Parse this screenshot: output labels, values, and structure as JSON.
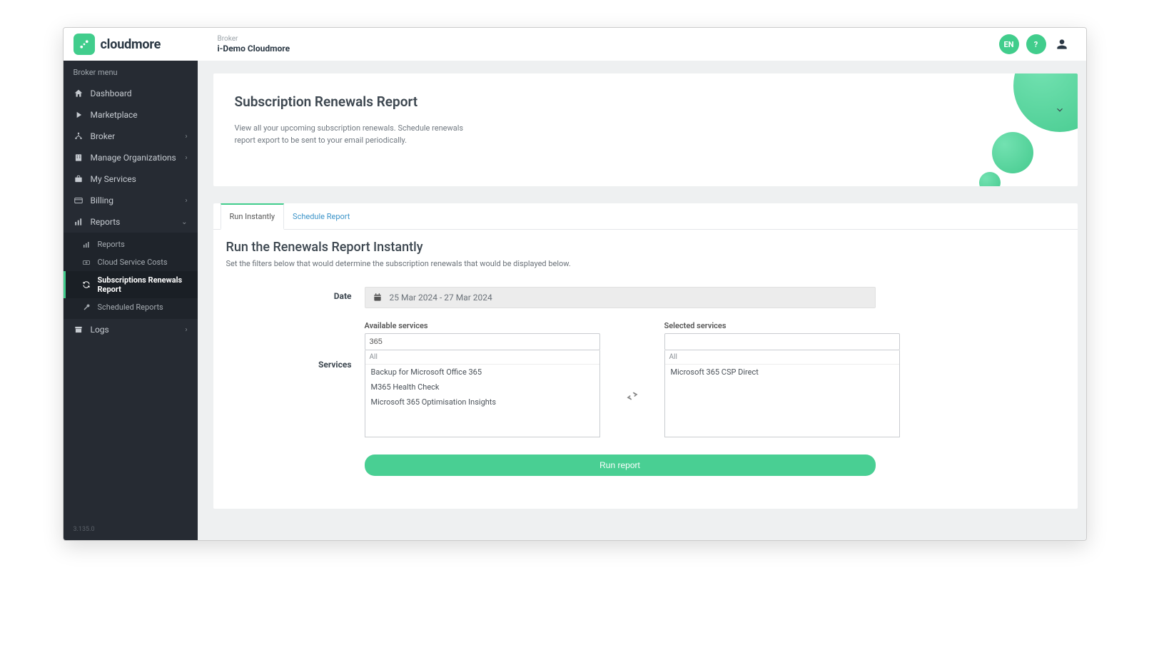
{
  "brand": {
    "name": "cloudmore"
  },
  "header": {
    "org_label": "Broker",
    "org_name": "i-Demo Cloudmore",
    "lang_pill": "EN",
    "help_pill": "?"
  },
  "sidebar": {
    "heading": "Broker menu",
    "items": [
      {
        "label": "Dashboard"
      },
      {
        "label": "Marketplace"
      },
      {
        "label": "Broker",
        "has_children": true
      },
      {
        "label": "Manage Organizations",
        "has_children": true
      },
      {
        "label": "My Services"
      },
      {
        "label": "Billing",
        "has_children": true
      },
      {
        "label": "Reports",
        "has_children": true,
        "expanded": true
      },
      {
        "label": "Logs",
        "has_children": true
      }
    ],
    "reports_sub": [
      {
        "label": "Reports"
      },
      {
        "label": "Cloud Service Costs"
      },
      {
        "label": "Subscriptions Renewals Report",
        "active": true
      },
      {
        "label": "Scheduled Reports"
      }
    ],
    "version": "3.135.0"
  },
  "hero": {
    "title": "Subscription Renewals Report",
    "description": "View all your upcoming subscription renewals. Schedule renewals report export to be sent to your email periodically."
  },
  "tabs": {
    "run": "Run Instantly",
    "schedule": "Schedule Report"
  },
  "section": {
    "title": "Run the Renewals Report Instantly",
    "description": "Set the filters below that would determine the subscription renewals that would be displayed below."
  },
  "form": {
    "date_label": "Date",
    "date_value": "25 Mar 2024 - 27 Mar 2024",
    "services_label": "Services",
    "available_label": "Available services",
    "selected_label": "Selected services",
    "available_search_value": "365",
    "all_label": "All",
    "available_items": [
      "Backup for Microsoft Office 365",
      "M365 Health Check",
      "Microsoft 365 Optimisation Insights"
    ],
    "selected_items": [
      "Microsoft 365 CSP Direct"
    ],
    "run_button": "Run report"
  }
}
